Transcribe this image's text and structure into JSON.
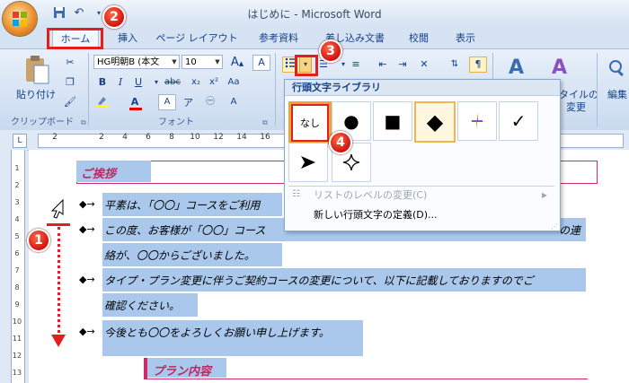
{
  "window": {
    "title": "はじめに - Microsoft Word"
  },
  "tabs": [
    {
      "label": "ホーム",
      "active": true
    },
    {
      "label": "挿入"
    },
    {
      "label": "ページ レイアウト"
    },
    {
      "label": "参考資料"
    },
    {
      "label": "差し込み文書"
    },
    {
      "label": "校閲"
    },
    {
      "label": "表示"
    }
  ],
  "ribbon": {
    "clipboard": {
      "paste_label": "貼り付け",
      "group_label": "クリップボード"
    },
    "font": {
      "font_name": "HG明朝B (本文",
      "font_size": "10",
      "group_label": "フォント"
    },
    "styles": {
      "change_styles_label_1": "タイルの",
      "change_styles_label_2": "変更"
    },
    "editing": {
      "label": "編集"
    }
  },
  "ruler": {
    "numbers": [
      "2",
      "",
      "2",
      "4",
      "6",
      "8",
      "10",
      "12",
      "14",
      "16",
      "18",
      "20",
      "22",
      "24",
      "26",
      "28",
      "30",
      "32"
    ]
  },
  "vruler": {
    "numbers": [
      "1",
      "2",
      "3",
      "4",
      "5",
      "6",
      "7",
      "8",
      "9",
      "10",
      "11",
      "12",
      "13"
    ]
  },
  "document": {
    "heading1": "ご挨拶",
    "line1": "平素は、「〇〇」コースをご利用",
    "line2": "この度、お客様が「〇〇」コース",
    "line2_tail": "の連",
    "line3": "絡が、〇〇からございました。",
    "line4": "タイプ・プラン変更に伴うご契約コースの変更について、以下に記載しておりますのでご",
    "line5": "確認ください。",
    "line6": "今後とも〇〇をよろしくお願い申し上げます。",
    "heading2": "プラン内容"
  },
  "gallery": {
    "title": "行頭文字ライブラリ",
    "none_label": "なし",
    "change_level": "リストのレベルの変更(C)",
    "define_new": "新しい行頭文字の定義(D)..."
  },
  "badges": [
    "1",
    "2",
    "3",
    "4"
  ],
  "colors": {
    "accent_red": "#e21e1e",
    "heading": "#c4245f",
    "selection": "#a9c8ec"
  }
}
